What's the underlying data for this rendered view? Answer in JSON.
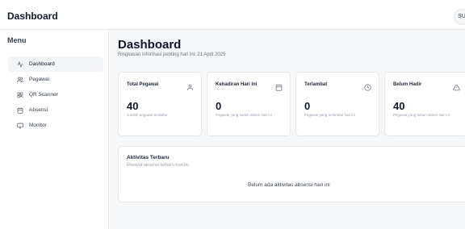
{
  "app": {
    "title": "Dashboard",
    "user_initials": "SU"
  },
  "sidebar": {
    "title": "Menu",
    "items": [
      {
        "label": "Dashboard",
        "icon": "activity-icon",
        "active": true
      },
      {
        "label": "Pegawai",
        "icon": "users-icon",
        "active": false
      },
      {
        "label": "QR Scanner",
        "icon": "qr-icon",
        "active": false
      },
      {
        "label": "Absensi",
        "icon": "calendar-icon",
        "active": false
      },
      {
        "label": "Monitor",
        "icon": "monitor-icon",
        "active": false
      }
    ]
  },
  "main": {
    "title": "Dashboard",
    "subtitle": "Ringkasan informasi penting hari ini: 21 April 2025",
    "cards": [
      {
        "title": "Total Pegawai",
        "icon": "user-icon",
        "value": "40",
        "desc": "Jumlah pegawai terdaftar"
      },
      {
        "title": "Kehadiran Hari Ini",
        "icon": "calendar-icon",
        "value": "0",
        "desc": "Pegawai yang sudah absen hari ini"
      },
      {
        "title": "Terlambat",
        "icon": "clock-icon",
        "value": "0",
        "desc": "Pegawai yang terlambat hari ini"
      },
      {
        "title": "Belum Hadir",
        "icon": "alert-triangle-icon",
        "value": "40",
        "desc": "Pegawai yang belum absen hari ini"
      }
    ],
    "activity": {
      "title": "Aktivitas Terbaru",
      "subtitle": "Riwayat absensi terbaru hari ini",
      "empty": "Belum ada aktivitas absensi hari ini"
    }
  },
  "colors": {
    "background": "#f5f6f8",
    "card": "#ffffff",
    "border": "#e5e7eb",
    "active_nav": "#f3f4f6"
  }
}
